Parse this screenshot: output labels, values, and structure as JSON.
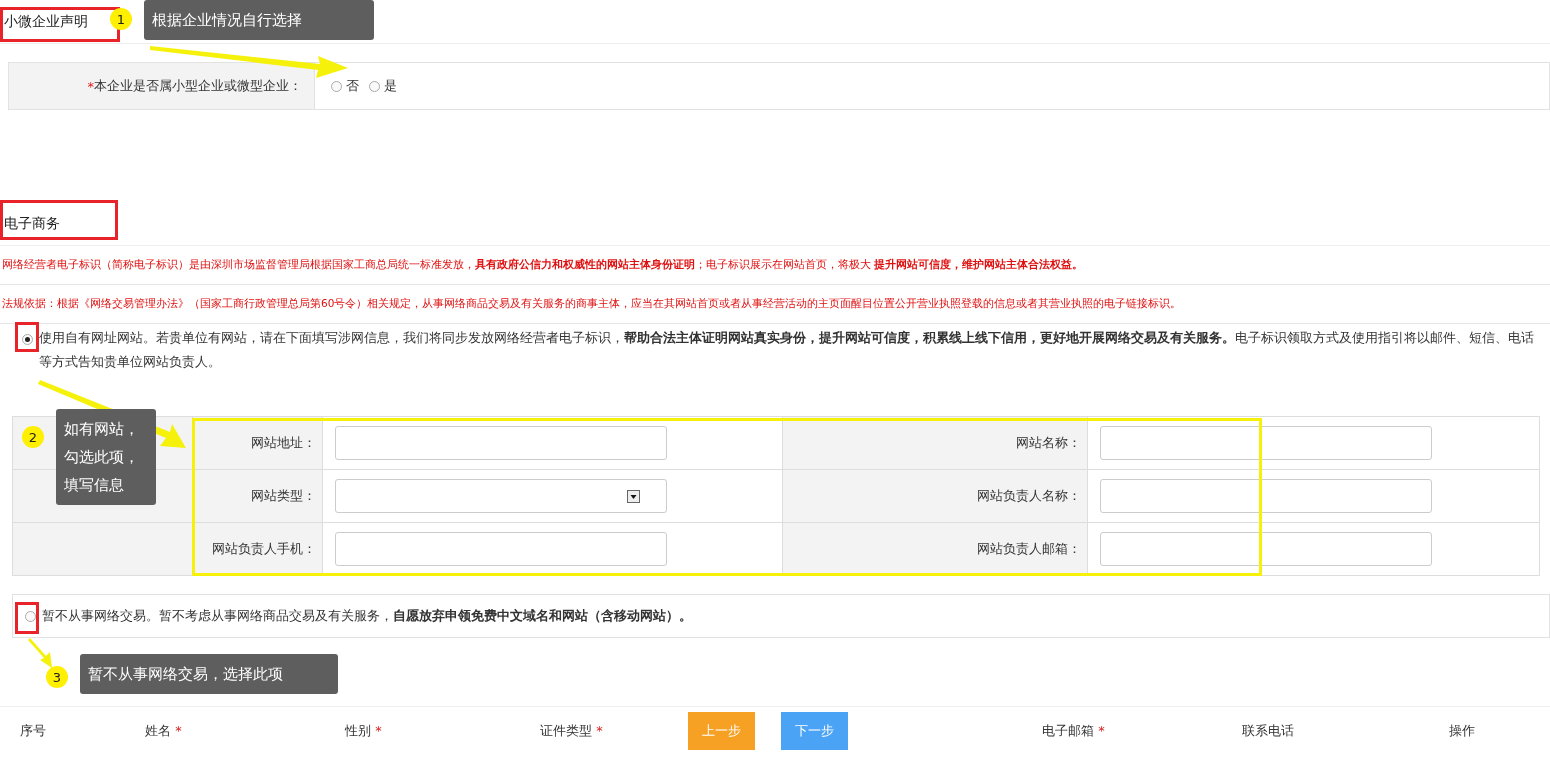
{
  "small_business": {
    "title": "小微企业声明",
    "question": {
      "required_mark": "*",
      "label": "本企业是否属小型企业或微型企业："
    },
    "options": [
      {
        "label": "否",
        "selected": false
      },
      {
        "label": "是",
        "selected": false
      }
    ]
  },
  "ecommerce": {
    "title": "电子商务",
    "notices": [
      "网络经营者电子标识（简称电子标识）是由深圳市场监督管理局根据国家工商总局统一标准发放，**具有政府公信力和权威性的网站主体身份证明**；电子标识展示在网站首页，将极大 **提升网站可信度，维护网站主体合法权益。**",
      "法规依据：根据《网络交易管理办法》（国家工商行政管理总局第60号令）相关规定，从事网络商品交易及有关服务的商事主体，应当在其网站首页或者从事经营活动的主页面醒目位置公开营业执照登载的信息或者其营业执照的电子链接标识。"
    ],
    "choices": [
      {
        "selected": true,
        "text": "使用自有网址网站。若贵单位有网站，请在下面填写涉网信息，我们将同步发放网络经营者电子标识，**帮助合法主体证明网站真实身份，提升网站可信度，积累线上线下信用，更好地开展网络交易及有关服务。**电子标识领取方式及使用指引将以邮件、短信、电话等方式告知贵单位网站负责人。"
      },
      {
        "selected": false,
        "text": "暂不从事网络交易。暂不考虑从事网络商品交易及有关服务，**自愿放弃申领免费中文域名和网站（含移动网站）。**"
      }
    ],
    "fields": [
      [
        {
          "label": "网站地址：",
          "kind": "text"
        },
        {
          "label": "网站名称：",
          "kind": "text"
        }
      ],
      [
        {
          "label": "网站类型：",
          "kind": "select"
        },
        {
          "label": "网站负责人名称：",
          "kind": "text"
        }
      ],
      [
        {
          "label": "网站负责人手机：",
          "kind": "text"
        },
        {
          "label": "网站负责人邮箱：",
          "kind": "text"
        }
      ]
    ]
  },
  "members_header": {
    "columns": [
      {
        "label": "序号",
        "required": false
      },
      {
        "label": "姓名",
        "required": true
      },
      {
        "label": "性别",
        "required": true
      },
      {
        "label": "证件类型",
        "required": true
      },
      {
        "label": "电子邮箱",
        "required": true
      },
      {
        "label": "联系电话",
        "required": false
      },
      {
        "label": "操作",
        "required": false
      }
    ],
    "buttons": [
      {
        "label": "上一步",
        "kind": "prev"
      },
      {
        "label": "下一步",
        "kind": "next"
      }
    ]
  },
  "callouts": [
    {
      "number": "1",
      "text": "根据企业情况自行选择"
    },
    {
      "number": "2",
      "text": "如有网站，勾选此项，填写信息"
    },
    {
      "number": "3",
      "text": "暂不从事网络交易，选择此项"
    }
  ]
}
